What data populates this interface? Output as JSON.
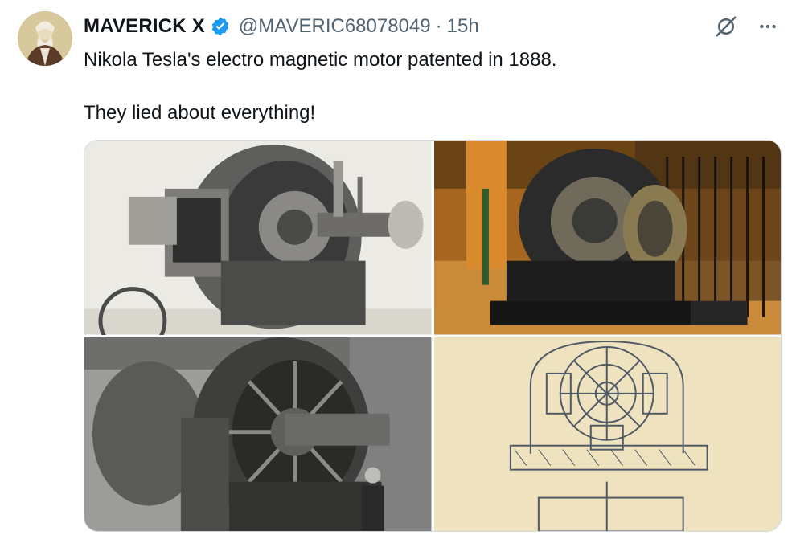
{
  "tweet": {
    "author_name": "MAVERICK X",
    "handle": "@MAVERIC68078049",
    "separator": "·",
    "time": "15h",
    "text_line1": "Nikola Tesla's electro magnetic motor patented in 1888.",
    "text_line2": "They lied about everything!"
  },
  "icons": {
    "verified": "verified-badge-icon",
    "grok": "grok-icon",
    "more": "more-icon"
  },
  "colors": {
    "verified": "#1d9bf0",
    "secondary_text": "#536471",
    "primary_text": "#0f1419",
    "border": "#cfd9de"
  },
  "media": {
    "images": [
      "tesla-motor-engraving-photo",
      "tesla-motor-museum-photo",
      "tesla-generator-with-man-photo",
      "tesla-motor-patent-drawing"
    ]
  }
}
